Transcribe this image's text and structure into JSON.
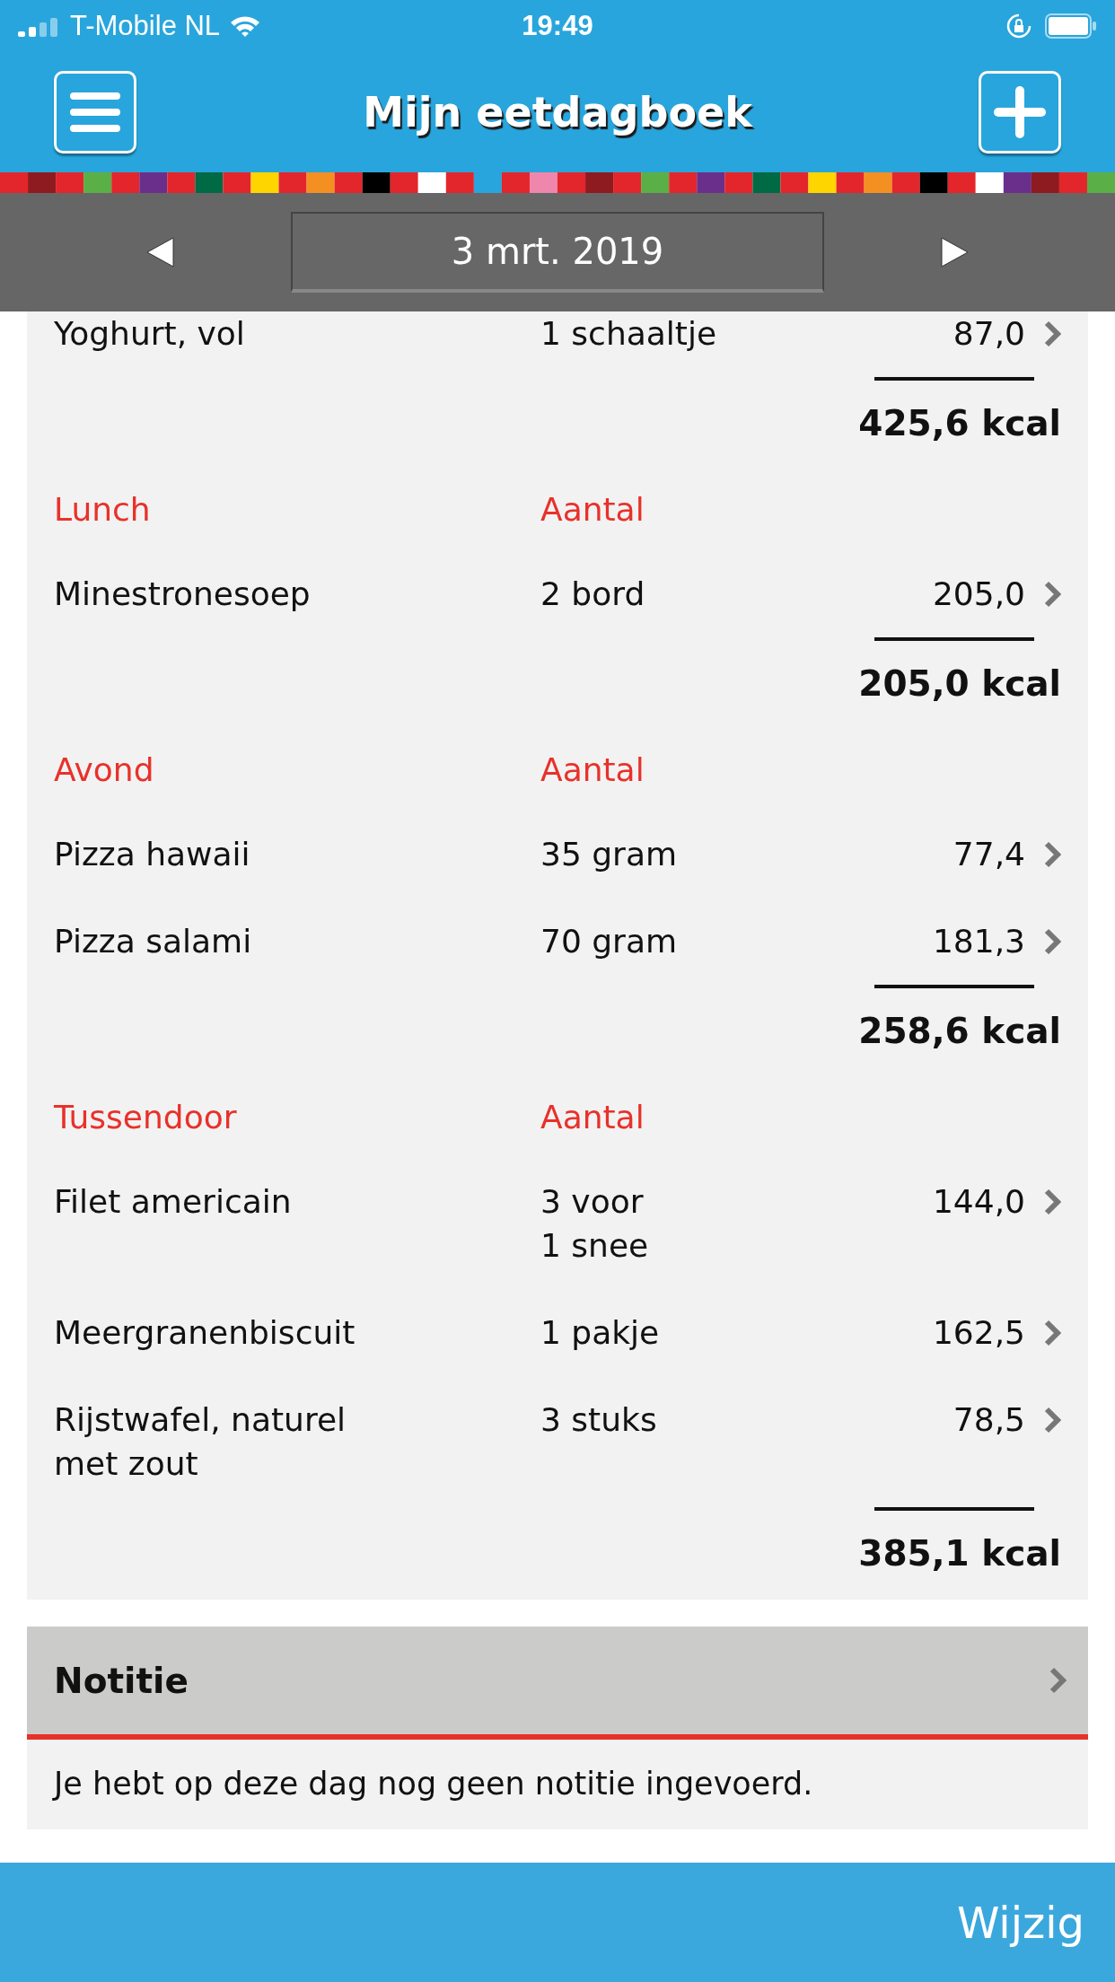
{
  "status_bar": {
    "carrier": "T-Mobile NL",
    "time": "19:49"
  },
  "header": {
    "title": "Mijn eetdagboek"
  },
  "date_nav": {
    "date": "3 mrt. 2019"
  },
  "meals": [
    {
      "items": [
        {
          "name": "Yoghurt, vol",
          "amount": "1 schaaltje",
          "kcal": "87,0"
        }
      ],
      "total": "425,6 kcal"
    },
    {
      "title": "Lunch",
      "amount_header": "Aantal",
      "items": [
        {
          "name": "Minestronesoep",
          "amount": "2 bord",
          "kcal": "205,0"
        }
      ],
      "total": "205,0 kcal"
    },
    {
      "title": "Avond",
      "amount_header": "Aantal",
      "items": [
        {
          "name": "Pizza hawaii",
          "amount": "35 gram",
          "kcal": "77,4"
        },
        {
          "name": "Pizza salami",
          "amount": "70 gram",
          "kcal": "181,3"
        }
      ],
      "total": "258,6 kcal"
    },
    {
      "title": "Tussendoor",
      "amount_header": "Aantal",
      "items": [
        {
          "name": "Filet americain",
          "amount": "3 voor\n1 snee",
          "kcal": "144,0"
        },
        {
          "name": "Meergranenbiscuit",
          "amount": "1 pakje",
          "kcal": "162,5"
        },
        {
          "name": "Rijstwafel, naturel\nmet zout",
          "amount": "3 stuks",
          "kcal": "78,5"
        }
      ],
      "total": "385,1 kcal"
    }
  ],
  "note": {
    "title": "Notitie",
    "text": "Je hebt op deze dag nog geen notitie ingevoerd."
  },
  "bottom_bar": {
    "button": "Wijzig"
  }
}
